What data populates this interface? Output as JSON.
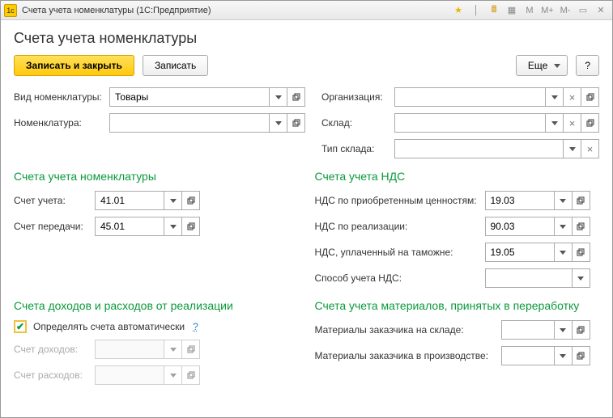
{
  "window": {
    "title": "Счета учета номенклатуры  (1С:Предприятие)"
  },
  "header": {
    "title": "Счета учета номенклатуры"
  },
  "toolbar": {
    "save_close": "Записать и закрыть",
    "save": "Записать",
    "more": "Еще",
    "help": "?"
  },
  "top": {
    "item_type_label": "Вид номенклатуры:",
    "item_type_value": "Товары",
    "item_label": "Номенклатура:",
    "item_value": "",
    "org_label": "Организация:",
    "org_value": "",
    "warehouse_label": "Склад:",
    "warehouse_value": "",
    "wtype_label": "Тип склада:",
    "wtype_value": ""
  },
  "sec_accounts": {
    "title": "Счета учета номенклатуры",
    "acc_label": "Счет учета:",
    "acc_value": "41.01",
    "transfer_label": "Счет передачи:",
    "transfer_value": "45.01"
  },
  "sec_vat": {
    "title": "Счета учета НДС",
    "purchased_label": "НДС по приобретенным ценностям:",
    "purchased_value": "19.03",
    "sales_label": "НДС по реализации:",
    "sales_value": "90.03",
    "customs_label": "НДС, уплаченный на таможне:",
    "customs_value": "19.05",
    "method_label": "Способ учета НДС:",
    "method_value": ""
  },
  "sec_income": {
    "title": "Счета доходов и расходов от реализации",
    "auto_label": "Определять счета автоматически",
    "auto_checked": true,
    "auto_help": "?",
    "income_label": "Счет доходов:",
    "income_value": "",
    "expense_label": "Счет расходов:",
    "expense_value": ""
  },
  "sec_materials": {
    "title": "Счета учета материалов, принятых в переработку",
    "in_stock_label": "Материалы заказчика на складе:",
    "in_stock_value": "",
    "in_prod_label": "Материалы заказчика в производстве:",
    "in_prod_value": ""
  }
}
